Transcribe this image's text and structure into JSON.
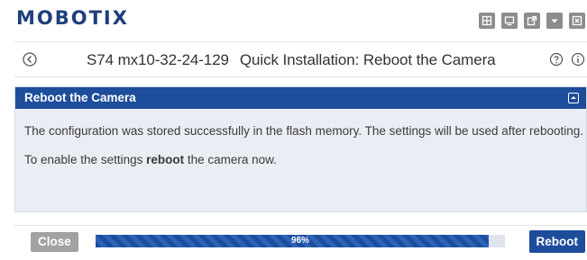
{
  "brand": {
    "logo_text": "MOBOTIX"
  },
  "toolbar": {
    "icons": [
      "layout-grid-icon",
      "monitor-icon",
      "external-link-icon",
      "dropdown-icon",
      "close-window-icon"
    ]
  },
  "title_bar": {
    "camera_name": "S74 mx10-32-24-129",
    "page_title": "Quick Installation: Reboot the Camera",
    "icons": [
      "back-icon",
      "help-icon",
      "info-icon"
    ]
  },
  "panel": {
    "header": "Reboot the Camera",
    "line1": "The configuration was stored successfully in the flash memory. The settings will be used after rebooting.",
    "line2_prefix": "To enable the settings ",
    "line2_bold": "reboot",
    "line2_suffix": " the camera now."
  },
  "actions": {
    "close_label": "Close",
    "progress_percent": 96,
    "progress_label": "96%",
    "reboot_label": "Reboot"
  },
  "colors": {
    "brand_blue": "#1d4d9b",
    "logo_blue": "#1f3e7c",
    "panel_bg": "#eaeef4",
    "button_gray": "#a2a2a2"
  }
}
